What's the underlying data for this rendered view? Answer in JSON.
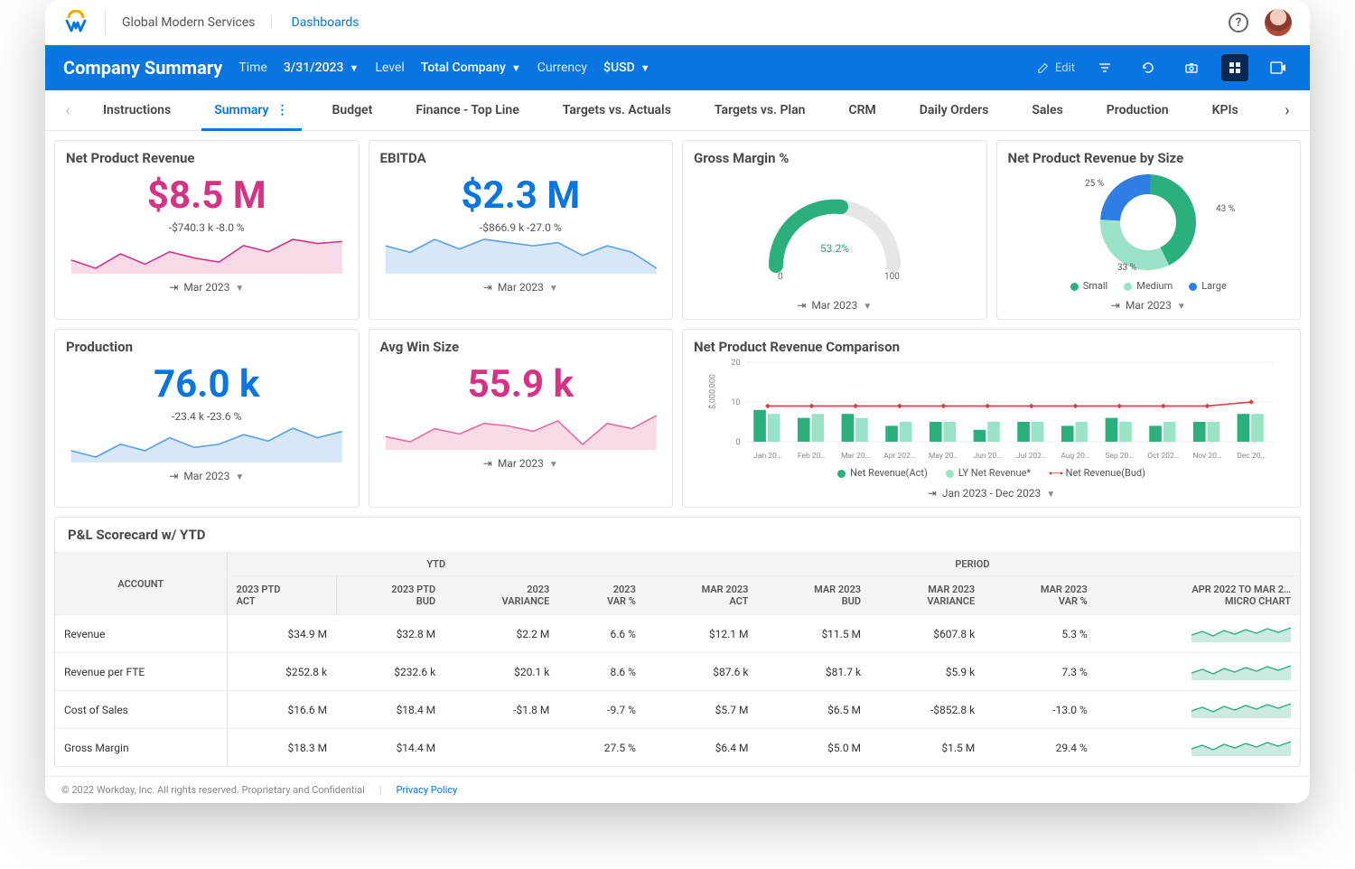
{
  "header": {
    "company": "Global Modern Services",
    "link": "Dashboards"
  },
  "bluebar": {
    "title": "Company Summary",
    "time_label": "Time",
    "time_value": "3/31/2023",
    "level_label": "Level",
    "level_value": "Total Company",
    "currency_label": "Currency",
    "currency_value": "$USD",
    "edit": "Edit"
  },
  "tabs": [
    "Instructions",
    "Summary",
    "Budget",
    "Finance - Top Line",
    "Targets vs. Actuals",
    "Targets vs. Plan",
    "CRM",
    "Daily Orders",
    "Sales",
    "Production",
    "KPIs"
  ],
  "active_tab": 1,
  "cards": {
    "net_rev": {
      "title": "Net Product Revenue",
      "value": "$8.5 M",
      "delta": "-$740.3 k   -8.0 %",
      "footer": "Mar 2023"
    },
    "ebitda": {
      "title": "EBITDA",
      "value": "$2.3 M",
      "delta": "-$866.9 k   -27.0 %",
      "footer": "Mar 2023"
    },
    "gross": {
      "title": "Gross Margin %",
      "value": "53.2%",
      "min": "0",
      "max": "100",
      "footer": "Mar 2023"
    },
    "by_size": {
      "title": "Net Product Revenue by Size",
      "footer": "Mar 2023",
      "labels": {
        "small": "Small",
        "medium": "Medium",
        "large": "Large"
      },
      "pct": {
        "small": "43 %",
        "medium": "33 %",
        "large": "25 %"
      }
    },
    "production": {
      "title": "Production",
      "value": "76.0 k",
      "delta": "-23.4 k   -23.6 %",
      "footer": "Mar 2023"
    },
    "winsize": {
      "title": "Avg Win Size",
      "value": "55.9 k",
      "delta": "",
      "footer": "Mar 2023"
    },
    "cmp": {
      "title": "Net Product Revenue Comparison",
      "ylabel": "$,000,000",
      "yticks": [
        "20",
        "10",
        "0"
      ],
      "footer": "Jan 2023 - Dec 2023",
      "legend": {
        "a": "Net Revenue(Act)",
        "b": "LY Net Revenue*",
        "c": "Net Revenue(Bud)"
      },
      "months": [
        "Jan 20…",
        "Feb 20…",
        "Mar 20…",
        "Apr 202…",
        "May 20…",
        "Jun 20…",
        "Jul 202…",
        "Aug 20…",
        "Sep 20…",
        "Oct 202…",
        "Nov 20…",
        "Dec 20…"
      ]
    }
  },
  "chart_data": {
    "net_rev_spark": {
      "type": "area",
      "values": [
        7.6,
        7.2,
        7.9,
        7.4,
        8.0,
        7.7,
        7.5,
        8.3,
        8.0,
        8.6,
        8.4,
        8.5
      ]
    },
    "ebitda_spark": {
      "type": "area",
      "values": [
        2.8,
        2.6,
        3.0,
        2.7,
        3.0,
        2.9,
        2.8,
        2.9,
        2.5,
        2.8,
        2.6,
        2.1
      ]
    },
    "production_spark": {
      "type": "area",
      "values": [
        72,
        70,
        74,
        72,
        76,
        73,
        74,
        77,
        75,
        79,
        76,
        78
      ]
    },
    "winsize_spark": {
      "type": "area",
      "values": [
        52,
        50,
        55,
        53,
        57,
        56,
        54,
        58,
        49,
        57,
        55,
        60
      ]
    },
    "gauge": {
      "type": "gauge",
      "value": 53.2,
      "min": 0,
      "max": 100
    },
    "donut": {
      "type": "pie",
      "series": [
        {
          "name": "Small",
          "value": 43,
          "color": "#2bb07d"
        },
        {
          "name": "Medium",
          "value": 33,
          "color": "#9be3c6"
        },
        {
          "name": "Large",
          "value": 25,
          "color": "#2f7ee6"
        }
      ]
    },
    "comparison": {
      "type": "bar",
      "ylim": [
        0,
        20
      ],
      "categories": [
        "Jan",
        "Feb",
        "Mar",
        "Apr",
        "May",
        "Jun",
        "Jul",
        "Aug",
        "Sep",
        "Oct",
        "Nov",
        "Dec"
      ],
      "series": [
        {
          "name": "Net Revenue(Act)",
          "color": "#2bb07d",
          "values": [
            8,
            6,
            7,
            4,
            5,
            3,
            5,
            4,
            6,
            4,
            5,
            7
          ]
        },
        {
          "name": "LY Net Revenue*",
          "color": "#9be3c6",
          "values": [
            7,
            7,
            6,
            5,
            5,
            5,
            5,
            5,
            5,
            5,
            5,
            7
          ]
        },
        {
          "name": "Net Revenue(Bud)",
          "type": "line",
          "color": "#e13b3b",
          "values": [
            9,
            9,
            9,
            9,
            9,
            9,
            9,
            9,
            9,
            9,
            9,
            10
          ]
        }
      ]
    }
  },
  "table": {
    "title": "P&L Scorecard w/ YTD",
    "group_headers": {
      "ytd": "YTD",
      "period": "PERIOD"
    },
    "columns": {
      "account": "ACCOUNT",
      "ytd_act": {
        "h1": "2023 PTD",
        "h2": "ACT"
      },
      "ytd_bud": {
        "h1": "2023 PTD",
        "h2": "BUD"
      },
      "ytd_var": {
        "h1": "2023",
        "h2": "VARIANCE"
      },
      "ytd_varpct": {
        "h1": "2023",
        "h2": "VAR %"
      },
      "p_act": {
        "h1": "MAR 2023",
        "h2": "ACT"
      },
      "p_bud": {
        "h1": "MAR 2023",
        "h2": "BUD"
      },
      "p_var": {
        "h1": "MAR 2023",
        "h2": "VARIANCE"
      },
      "p_varpct": {
        "h1": "MAR 2023",
        "h2": "VAR %"
      },
      "micro": {
        "h1": "APR 2022 TO MAR 2…",
        "h2": "MICRO CHART"
      }
    },
    "rows": [
      {
        "account": "Revenue",
        "ytd_act": "$34.9 M",
        "ytd_bud": "$32.8 M",
        "ytd_var": "$2.2 M",
        "ytd_varpct": "6.6 %",
        "p_act": "$12.1 M",
        "p_bud": "$11.5 M",
        "p_var": "$607.8 k",
        "p_varpct": "5.3 %"
      },
      {
        "account": "Revenue per FTE",
        "ytd_act": "$252.8 k",
        "ytd_bud": "$232.6 k",
        "ytd_var": "$20.1 k",
        "ytd_varpct": "8.6 %",
        "p_act": "$87.6 k",
        "p_bud": "$81.7 k",
        "p_var": "$5.9 k",
        "p_varpct": "7.3 %"
      },
      {
        "account": "Cost of Sales",
        "ytd_act": "$16.6 M",
        "ytd_bud": "$18.4 M",
        "ytd_var": "-$1.8 M",
        "ytd_varpct": "-9.7 %",
        "p_act": "$5.7 M",
        "p_bud": "$6.5 M",
        "p_var": "-$852.8 k",
        "p_varpct": "-13.0 %"
      },
      {
        "account": "Gross Margin",
        "ytd_act": "$18.3 M",
        "ytd_bud": "$14.4 M",
        "ytd_var": "",
        "ytd_varpct": "27.5 %",
        "p_act": "$6.4 M",
        "p_bud": "$5.0 M",
        "p_var": "$1.5 M",
        "p_varpct": "29.4 %"
      }
    ]
  },
  "footer": {
    "copyright": "© 2022 Workday, Inc. All rights reserved. Proprietary and Confidential",
    "privacy": "Privacy Policy"
  }
}
